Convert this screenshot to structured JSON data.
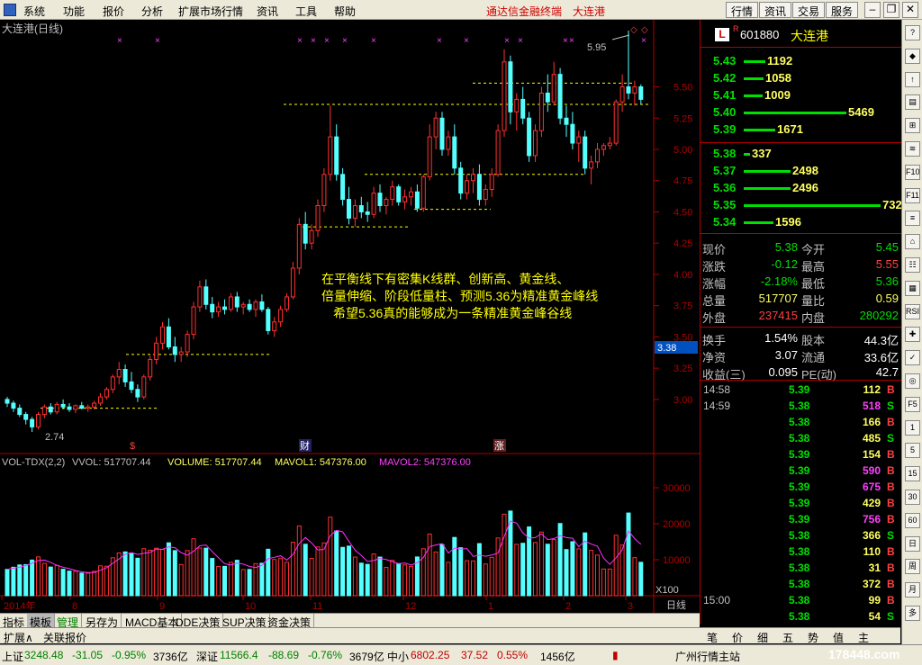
{
  "menu": {
    "items": [
      "系统",
      "功能",
      "报价",
      "分析",
      "扩展市场行情",
      "资讯",
      "工具",
      "帮助"
    ],
    "app_title": "通达信金融终端",
    "stock_title": "大连港",
    "toolbar_buttons": [
      "行情",
      "资讯",
      "交易",
      "服务"
    ]
  },
  "chart": {
    "title": "大连港(日线)",
    "price_axis": [
      "5.50",
      "5.25",
      "5.00",
      "4.75",
      "4.50",
      "4.25",
      "4.00",
      "3.75",
      "3.50",
      "3.25",
      "3.00"
    ],
    "current_price_label": "3.38",
    "high_label": "5.95",
    "low_label": "2.74",
    "annotation_lines": [
      "在平衡线下有密集K线群、创新高、黄金线、",
      "倍量伸缩、阶段低量柱、预测5.36为精准黄金峰线",
      "希望5.36真的能够成为一条精准黄金峰谷线"
    ],
    "markers": [
      "$",
      "财",
      "涨"
    ],
    "time_axis": [
      "2014年",
      "8",
      "9",
      "10",
      "11",
      "12",
      "1",
      "2",
      "3"
    ],
    "period_label": "日线",
    "vol_header": {
      "name": "VOL-TDX(2,2)",
      "vvol": "VVOL: 517707.44",
      "volume": "VOLUME: 517707.44",
      "mavol1": "MAVOL1: 547376.00",
      "mavol2": "MAVOL2: 547376.00"
    },
    "vol_axis": [
      "30000",
      "20000",
      "10000"
    ],
    "vol_unit": "X100",
    "colors": {
      "up": "#ff3030",
      "down": "#54ffff",
      "ma1": "#ffffff",
      "ma2": "#ff30ff",
      "annotation": "#ffff00",
      "dashed": "#ffff00"
    }
  },
  "chart_data": {
    "type": "candlestick",
    "x_range": [
      "2014年",
      "3"
    ],
    "ylim": [
      2.74,
      5.95
    ],
    "bars": [
      [
        3.0,
        3.02,
        2.94,
        2.97
      ],
      [
        2.97,
        2.99,
        2.9,
        2.93
      ],
      [
        2.93,
        2.96,
        2.86,
        2.88
      ],
      [
        2.88,
        2.9,
        2.8,
        2.84
      ],
      [
        2.84,
        2.86,
        2.74,
        2.78
      ],
      [
        2.78,
        2.9,
        2.76,
        2.88
      ],
      [
        2.88,
        2.96,
        2.85,
        2.94
      ],
      [
        2.94,
        2.97,
        2.88,
        2.9
      ],
      [
        2.9,
        2.98,
        2.88,
        2.96
      ],
      [
        2.96,
        3.0,
        2.92,
        2.94
      ],
      [
        2.94,
        2.97,
        2.9,
        2.92
      ],
      [
        2.92,
        2.96,
        2.89,
        2.95
      ],
      [
        2.95,
        2.98,
        2.92,
        2.93
      ],
      [
        2.93,
        2.96,
        2.9,
        2.94
      ],
      [
        2.94,
        2.99,
        2.92,
        2.97
      ],
      [
        2.97,
        3.05,
        2.95,
        3.02
      ],
      [
        3.02,
        3.1,
        3.0,
        3.08
      ],
      [
        3.08,
        3.2,
        3.05,
        3.18
      ],
      [
        3.18,
        3.3,
        3.12,
        3.24
      ],
      [
        3.24,
        3.28,
        3.1,
        3.14
      ],
      [
        3.14,
        3.22,
        3.05,
        3.08
      ],
      [
        3.08,
        3.12,
        2.98,
        3.02
      ],
      [
        3.02,
        3.2,
        3.0,
        3.18
      ],
      [
        3.18,
        3.35,
        3.15,
        3.32
      ],
      [
        3.32,
        3.5,
        3.28,
        3.45
      ],
      [
        3.45,
        3.62,
        3.4,
        3.58
      ],
      [
        3.58,
        3.65,
        3.4,
        3.42
      ],
      [
        3.42,
        3.5,
        3.3,
        3.36
      ],
      [
        3.36,
        3.42,
        3.3,
        3.38
      ],
      [
        3.38,
        3.55,
        3.34,
        3.52
      ],
      [
        3.52,
        3.78,
        3.48,
        3.74
      ],
      [
        3.74,
        3.95,
        3.7,
        3.9
      ],
      [
        3.9,
        3.96,
        3.72,
        3.76
      ],
      [
        3.76,
        3.82,
        3.65,
        3.7
      ],
      [
        3.7,
        3.78,
        3.66,
        3.74
      ],
      [
        3.74,
        3.8,
        3.68,
        3.72
      ],
      [
        3.72,
        3.85,
        3.7,
        3.82
      ],
      [
        3.82,
        3.86,
        3.7,
        3.74
      ],
      [
        3.74,
        3.78,
        3.68,
        3.76
      ],
      [
        3.76,
        3.8,
        3.7,
        3.72
      ],
      [
        3.72,
        3.8,
        3.66,
        3.78
      ],
      [
        3.78,
        3.84,
        3.7,
        3.72
      ],
      [
        3.72,
        3.74,
        3.52,
        3.55
      ],
      [
        3.55,
        3.66,
        3.5,
        3.62
      ],
      [
        3.62,
        3.75,
        3.58,
        3.72
      ],
      [
        3.72,
        3.85,
        3.7,
        3.82
      ],
      [
        3.82,
        4.1,
        3.8,
        4.05
      ],
      [
        4.05,
        4.45,
        4.0,
        4.4
      ],
      [
        4.4,
        4.5,
        4.2,
        4.25
      ],
      [
        4.25,
        4.4,
        4.2,
        4.35
      ],
      [
        4.35,
        4.6,
        4.3,
        4.55
      ],
      [
        4.55,
        4.85,
        4.5,
        4.8
      ],
      [
        4.8,
        5.35,
        4.75,
        5.1
      ],
      [
        5.1,
        5.2,
        4.75,
        4.8
      ],
      [
        4.8,
        4.85,
        4.55,
        4.6
      ],
      [
        4.6,
        4.7,
        4.4,
        4.45
      ],
      [
        4.45,
        4.6,
        4.38,
        4.55
      ],
      [
        4.55,
        4.62,
        4.45,
        4.5
      ],
      [
        4.5,
        4.58,
        4.42,
        4.48
      ],
      [
        4.48,
        4.7,
        4.45,
        4.65
      ],
      [
        4.65,
        4.72,
        4.5,
        4.55
      ],
      [
        4.55,
        4.62,
        4.48,
        4.6
      ],
      [
        4.6,
        4.75,
        4.55,
        4.7
      ],
      [
        4.7,
        4.72,
        4.55,
        4.58
      ],
      [
        4.58,
        4.68,
        4.52,
        4.62
      ],
      [
        4.62,
        4.7,
        4.55,
        4.66
      ],
      [
        4.66,
        4.72,
        4.5,
        4.53
      ],
      [
        4.53,
        4.8,
        4.5,
        4.78
      ],
      [
        4.78,
        5.2,
        4.75,
        5.1
      ],
      [
        5.1,
        5.3,
        5.0,
        5.25
      ],
      [
        5.25,
        5.3,
        4.95,
        5.0
      ],
      [
        5.0,
        5.15,
        4.95,
        5.1
      ],
      [
        5.1,
        5.2,
        4.8,
        4.85
      ],
      [
        4.85,
        4.9,
        4.6,
        4.65
      ],
      [
        4.65,
        4.8,
        4.6,
        4.75
      ],
      [
        4.75,
        4.85,
        4.65,
        4.8
      ],
      [
        4.8,
        4.88,
        4.55,
        4.6
      ],
      [
        4.6,
        4.72,
        4.55,
        4.68
      ],
      [
        4.68,
        4.85,
        4.62,
        4.8
      ],
      [
        4.8,
        5.2,
        4.78,
        5.15
      ],
      [
        5.15,
        5.8,
        5.1,
        5.7
      ],
      [
        5.7,
        5.75,
        5.2,
        5.3
      ],
      [
        5.3,
        5.45,
        5.15,
        5.4
      ],
      [
        5.4,
        5.5,
        5.2,
        5.25
      ],
      [
        5.25,
        5.3,
        4.9,
        4.95
      ],
      [
        4.95,
        5.2,
        4.9,
        5.15
      ],
      [
        5.15,
        5.5,
        5.1,
        5.45
      ],
      [
        5.45,
        5.6,
        5.3,
        5.38
      ],
      [
        5.38,
        5.7,
        5.35,
        5.6
      ],
      [
        5.6,
        5.65,
        5.2,
        5.25
      ],
      [
        5.25,
        5.35,
        5.1,
        5.2
      ],
      [
        5.2,
        5.3,
        5.0,
        5.05
      ],
      [
        5.05,
        5.15,
        4.9,
        5.1
      ],
      [
        5.1,
        5.15,
        4.8,
        4.85
      ],
      [
        4.85,
        4.95,
        4.72,
        4.9
      ],
      [
        4.9,
        5.05,
        4.85,
        5.0
      ],
      [
        5.0,
        5.05,
        4.95,
        5.03
      ],
      [
        5.03,
        5.1,
        5.0,
        5.05
      ],
      [
        5.05,
        5.4,
        5.03,
        5.38
      ],
      [
        5.38,
        5.6,
        5.3,
        5.5
      ],
      [
        5.5,
        5.95,
        5.4,
        5.45
      ],
      [
        5.45,
        5.55,
        5.35,
        5.5
      ],
      [
        5.5,
        5.52,
        5.36,
        5.4
      ]
    ],
    "volume_scale": [
      0,
      35000
    ]
  },
  "right_panel": {
    "code": "601880",
    "name": "大连港",
    "badge": "L",
    "badge_mark": "R",
    "asks": [
      {
        "price": "5.43",
        "vol": "1192",
        "bar": 24
      },
      {
        "price": "5.42",
        "vol": "1058",
        "bar": 22
      },
      {
        "price": "5.41",
        "vol": "1009",
        "bar": 21
      },
      {
        "price": "5.40",
        "vol": "5469",
        "bar": 114
      },
      {
        "price": "5.39",
        "vol": "1671",
        "bar": 35
      }
    ],
    "bids": [
      {
        "price": "5.38",
        "vol": "337",
        "bar": 7
      },
      {
        "price": "5.37",
        "vol": "2498",
        "bar": 52
      },
      {
        "price": "5.36",
        "vol": "2496",
        "bar": 52
      },
      {
        "price": "5.35",
        "vol": "7321",
        "bar": 152
      },
      {
        "price": "5.34",
        "vol": "1596",
        "bar": 33
      }
    ],
    "stats": [
      {
        "k": "现价",
        "v": "5.38",
        "vc": "#00e000",
        "k2": "今开",
        "v2": "5.45",
        "v2c": "#00e000"
      },
      {
        "k": "涨跌",
        "v": "-0.12",
        "vc": "#00e000",
        "k2": "最高",
        "v2": "5.55",
        "v2c": "#ff4040"
      },
      {
        "k": "涨幅",
        "v": "-2.18%",
        "vc": "#00e000",
        "k2": "最低",
        "v2": "5.36",
        "v2c": "#00e000"
      },
      {
        "k": "总量",
        "v": "517707",
        "vc": "#ffff60",
        "k2": "量比",
        "v2": "0.59",
        "v2c": "#ffff60"
      },
      {
        "k": "外盘",
        "v": "237415",
        "vc": "#ff4040",
        "k2": "内盘",
        "v2": "280292",
        "v2c": "#00e000"
      },
      {
        "k": "换手",
        "v": "1.54%",
        "vc": "#ffffff",
        "k2": "股本",
        "v2": "44.3亿",
        "v2c": "#ffffff"
      },
      {
        "k": "净资",
        "v": "3.07",
        "vc": "#ffffff",
        "k2": "流通",
        "v2": "33.6亿",
        "v2c": "#ffffff"
      },
      {
        "k": "收益(三)",
        "v": "0.095",
        "vc": "#ffffff",
        "k2": "PE(动)",
        "v2": "42.7",
        "v2c": "#ffffff"
      }
    ],
    "ticks": [
      {
        "t": "14:58",
        "p": "5.39",
        "q": "112",
        "qc": "#ffff60",
        "bs": "B",
        "bsc": "#ff4040"
      },
      {
        "t": "14:59",
        "p": "5.38",
        "q": "518",
        "qc": "#ff40ff",
        "bs": "S",
        "bsc": "#00e000"
      },
      {
        "t": "",
        "p": "5.38",
        "q": "166",
        "qc": "#ffff60",
        "bs": "B",
        "bsc": "#ff4040"
      },
      {
        "t": "",
        "p": "5.38",
        "q": "485",
        "qc": "#ffff60",
        "bs": "S",
        "bsc": "#00e000"
      },
      {
        "t": "",
        "p": "5.39",
        "q": "154",
        "qc": "#ffff60",
        "bs": "B",
        "bsc": "#ff4040"
      },
      {
        "t": "",
        "p": "5.39",
        "q": "590",
        "qc": "#ff40ff",
        "bs": "B",
        "bsc": "#ff4040"
      },
      {
        "t": "",
        "p": "5.39",
        "q": "675",
        "qc": "#ff40ff",
        "bs": "B",
        "bsc": "#ff4040"
      },
      {
        "t": "",
        "p": "5.39",
        "q": "429",
        "qc": "#ffff60",
        "bs": "B",
        "bsc": "#ff4040"
      },
      {
        "t": "",
        "p": "5.39",
        "q": "756",
        "qc": "#ff40ff",
        "bs": "B",
        "bsc": "#ff4040"
      },
      {
        "t": "",
        "p": "5.38",
        "q": "366",
        "qc": "#ffff60",
        "bs": "S",
        "bsc": "#00e000"
      },
      {
        "t": "",
        "p": "5.38",
        "q": "110",
        "qc": "#ffff60",
        "bs": "B",
        "bsc": "#ff4040"
      },
      {
        "t": "",
        "p": "5.38",
        "q": "31",
        "qc": "#ffff60",
        "bs": "B",
        "bsc": "#ff4040"
      },
      {
        "t": "",
        "p": "5.38",
        "q": "372",
        "qc": "#ffff60",
        "bs": "B",
        "bsc": "#ff4040"
      },
      {
        "t": "15:00",
        "p": "5.38",
        "q": "99",
        "qc": "#ffff60",
        "bs": "B",
        "bsc": "#ff4040"
      },
      {
        "t": "",
        "p": "5.38",
        "q": "54",
        "qc": "#ffff60",
        "bs": "S",
        "bsc": "#00e000"
      }
    ],
    "tabs": [
      "笔",
      "价",
      "细",
      "五",
      "势",
      "值",
      "主"
    ]
  },
  "side_tools": [
    "?",
    "◆",
    "↑",
    "▤",
    "⊞",
    "≋",
    "F10",
    "F11",
    "≡",
    "⌂",
    "☷",
    "▦",
    "RSI",
    "✚",
    "✓",
    "◎",
    "F5",
    "1",
    "5",
    "15",
    "30",
    "60",
    "日",
    "周",
    "月",
    "多"
  ],
  "bottom_tabs": [
    "指标",
    "模板",
    "管理",
    "另存为",
    "MACD基本",
    "DDE决策",
    "SUP决策",
    "资金决策"
  ],
  "ext_bar": [
    "扩展∧",
    "关联报价"
  ],
  "status": {
    "sh_label": "上证",
    "sh_value": "3248.48",
    "sh_change": "-31.05",
    "sh_pct": "-0.95%",
    "sh_amount": "3736亿",
    "sz_label": "深证",
    "sz_value": "11566.4",
    "sz_change": "-88.69",
    "sz_pct": "-0.76%",
    "sz_amount": "3679亿",
    "zx_label": "中小",
    "zx_value": "6802.25",
    "zx_change": "37.52",
    "zx_pct": "0.55%",
    "zx_amount": "1456亿",
    "server": "广州行情主站",
    "watermark": "178448.com"
  }
}
